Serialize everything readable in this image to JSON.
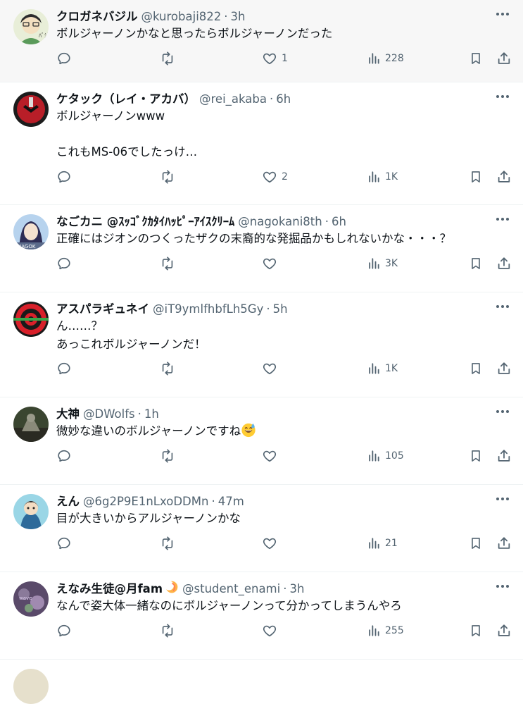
{
  "tweets": [
    {
      "name": "クロガネバジル",
      "handle": "@kurobaji822",
      "time": "3h",
      "text": "ボルジャーノンかなと思ったらボルジャーノンだった",
      "likes": "1",
      "views": "228",
      "avatar": {
        "colors": [
          "#dfe9c8",
          "#4f8a4f"
        ]
      }
    },
    {
      "name": "ケタック（レイ・アカバ）",
      "handle": "@rei_akaba",
      "time": "6h",
      "text": "ボルジャーノンwww\n\nこれもMS-06でしたっけ…",
      "likes": "2",
      "views": "1K",
      "avatar": {
        "colors": [
          "#1c1c1c",
          "#c8202a"
        ]
      }
    },
    {
      "name": "なごカニ @ｽｯｺﾞｸｶﾀｲﾊｯﾋﾟｰｱｲｽｸﾘｰﾑ",
      "handle": "@nagokani8th",
      "time": "6h",
      "text": "正確にはジオンのつくったザクの末裔的な発掘品かもしれないかな・・・？",
      "likes": "",
      "views": "3K",
      "avatar": {
        "colors": [
          "#a9c7e8",
          "#3b3b6e"
        ]
      }
    },
    {
      "name": "アスパラギュネイ",
      "handle": "@iT9ymlfhbfLh5Gy",
      "time": "5h",
      "text": "ん……？\nあっこれボルジャーノンだ！",
      "likes": "",
      "views": "1K",
      "avatar": {
        "colors": [
          "#d8202a",
          "#1a1a1a",
          "#3aa64a"
        ]
      }
    },
    {
      "name": "大神",
      "handle": "@DWolfs",
      "time": "1h",
      "text": "微妙な違いのボルジャーノンですね",
      "has_emoji": true,
      "emoji": "grinning-sweat-emoji",
      "likes": "",
      "views": "105",
      "avatar": {
        "colors": [
          "#2f3a2a",
          "#8a8a7a"
        ]
      }
    },
    {
      "name": "えん",
      "handle": "@6g2P9E1nLxoDDMn",
      "time": "47m",
      "text": "目が大きいからアルジャーノンかな",
      "likes": "",
      "views": "21",
      "avatar": {
        "colors": [
          "#8fcfe0",
          "#2d6a9a"
        ]
      }
    },
    {
      "name": "えなみ生徒@月fam",
      "name_badge": "crescent-moon-badge",
      "handle": "@student_enami",
      "time": "3h",
      "text": "なんで姿大体一緒なのにボルジャーノンって分かってしまうんやろ",
      "likes": "",
      "views": "255",
      "avatar": {
        "colors": [
          "#6a5a7a",
          "#a08ab0"
        ]
      }
    }
  ],
  "icons": {
    "reply": "reply-icon",
    "retweet": "retweet-icon",
    "like": "like-icon",
    "views": "views-icon",
    "bookmark": "bookmark-icon",
    "share": "share-icon",
    "more": "more-icon"
  },
  "colors": {
    "text": "#0f1419",
    "muted": "#536471",
    "border": "#eff3f4",
    "highlight_bg": "#f7f7f7"
  }
}
